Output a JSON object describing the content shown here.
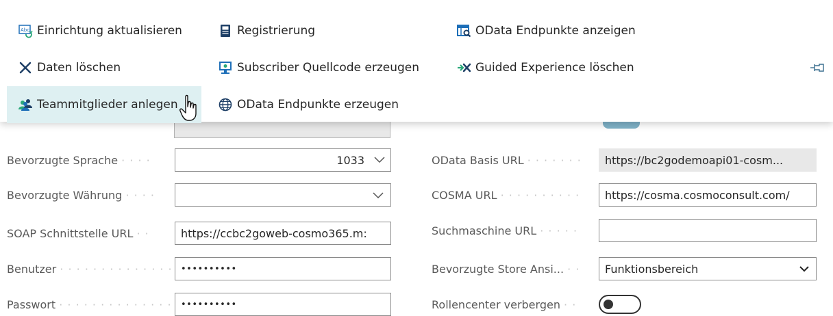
{
  "menu": {
    "items": [
      {
        "label": "Einrichtung aktualisieren",
        "icon": "refresh-setup-icon"
      },
      {
        "label": "Registrierung",
        "icon": "registration-book-icon"
      },
      {
        "label": "OData Endpunkte anzeigen",
        "icon": "odata-view-icon"
      },
      {
        "label": "Daten löschen",
        "icon": "close-x-icon"
      },
      {
        "label": "Subscriber Quellcode erzeugen",
        "icon": "monitor-code-icon"
      },
      {
        "label": "Guided Experience löschen",
        "icon": "arrow-delete-icon"
      },
      {
        "label": "Teammitglieder anlegen",
        "icon": "team-members-icon"
      },
      {
        "label": "OData Endpunkte erzeugen",
        "icon": "globe-icon"
      }
    ],
    "pin_icon": "pin-icon"
  },
  "form": {
    "left": [
      {
        "label": "Bevorzugte Sprache",
        "value": "1033"
      },
      {
        "label": "Bevorzugte Währung",
        "value": ""
      },
      {
        "label": "SOAP Schnittstelle URL",
        "value": "https://ccbc2goweb-cosmo365.m:"
      },
      {
        "label": "Benutzer",
        "value": "••••••••••"
      },
      {
        "label": "Passwort",
        "value": "••••••••••"
      }
    ],
    "right": [
      {
        "label": "OData Basis URL",
        "value": "https://bc2godemoapi01-cosm..."
      },
      {
        "label": "COSMA URL",
        "value": "https://cosma.cosmoconsult.com/"
      },
      {
        "label": "Suchmaschine URL",
        "value": ""
      },
      {
        "label": "Bevorzugte Store Ansi...",
        "value": "Funktionsbereich"
      },
      {
        "label": "Rollencenter verbergen",
        "value": false
      }
    ]
  },
  "colors": {
    "hover": "#def0f2",
    "accent": "#008489",
    "toggle_on_partial": "#7fb2c8"
  }
}
